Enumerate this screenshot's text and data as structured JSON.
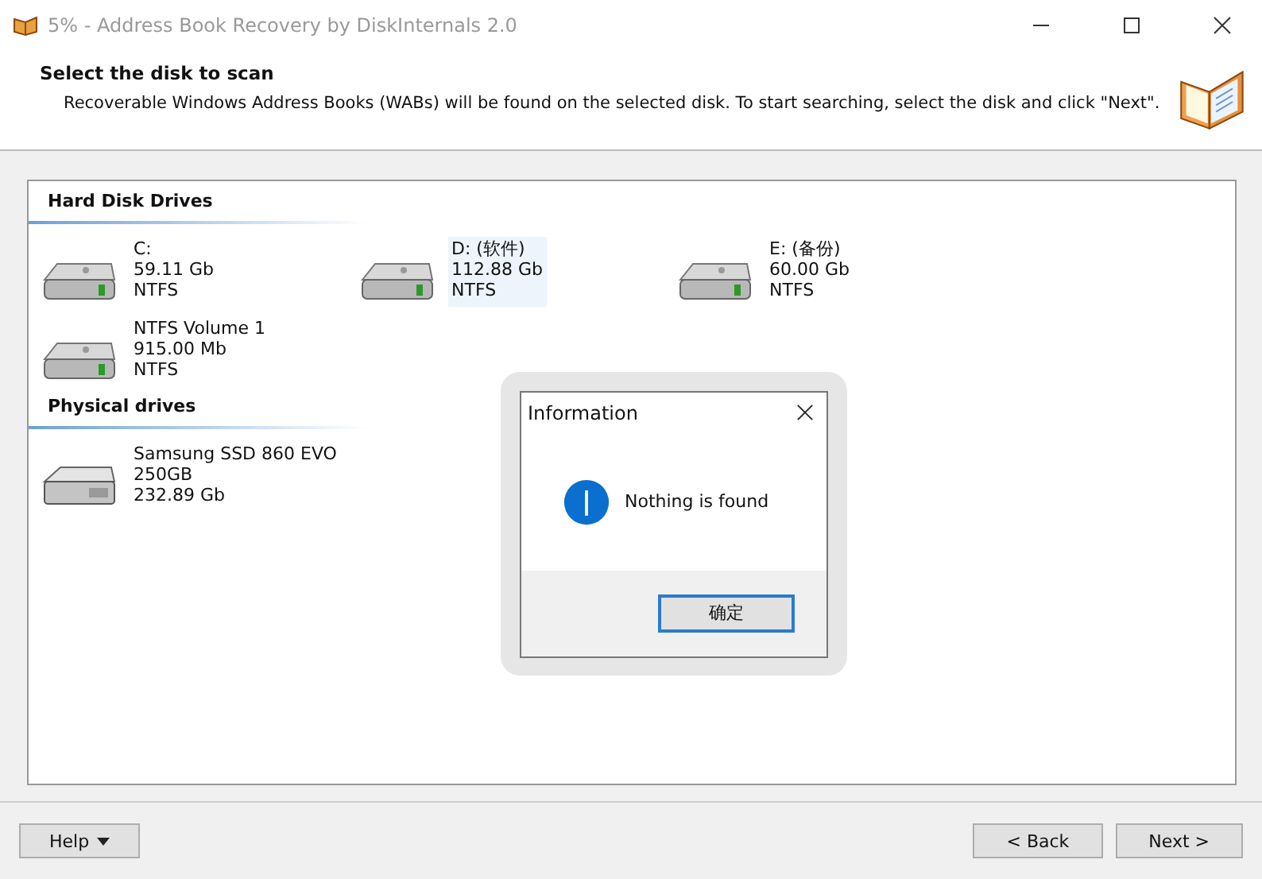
{
  "window": {
    "title": "5% - Address Book Recovery by DiskInternals 2.0"
  },
  "header": {
    "title": "Select the disk to scan",
    "description": "Recoverable Windows Address Books (WABs) will be found on the selected disk. To start searching, select the disk and click \"Next\"."
  },
  "groups": [
    {
      "title": "Hard Disk Drives",
      "kind": "volume",
      "items": [
        {
          "name": "C:",
          "size": "59.11 Gb",
          "detail": "NTFS",
          "selected": false
        },
        {
          "name": "D: (软件)",
          "size": "112.88 Gb",
          "detail": "NTFS",
          "selected": true
        },
        {
          "name": "E: (备份)",
          "size": "60.00 Gb",
          "detail": "NTFS",
          "selected": false
        },
        {
          "name": "NTFS Volume 1",
          "size": "915.00 Mb",
          "detail": "NTFS",
          "selected": false
        }
      ]
    },
    {
      "title": "Physical drives",
      "kind": "physical",
      "items": [
        {
          "name": "Samsung SSD 860 EVO",
          "size": "250GB",
          "detail": "232.89 Gb",
          "selected": false
        }
      ]
    }
  ],
  "dialog": {
    "title": "Information",
    "message": "Nothing is found",
    "button": "确定"
  },
  "footer": {
    "help": "Help",
    "back": "< Back",
    "next": "Next >"
  }
}
